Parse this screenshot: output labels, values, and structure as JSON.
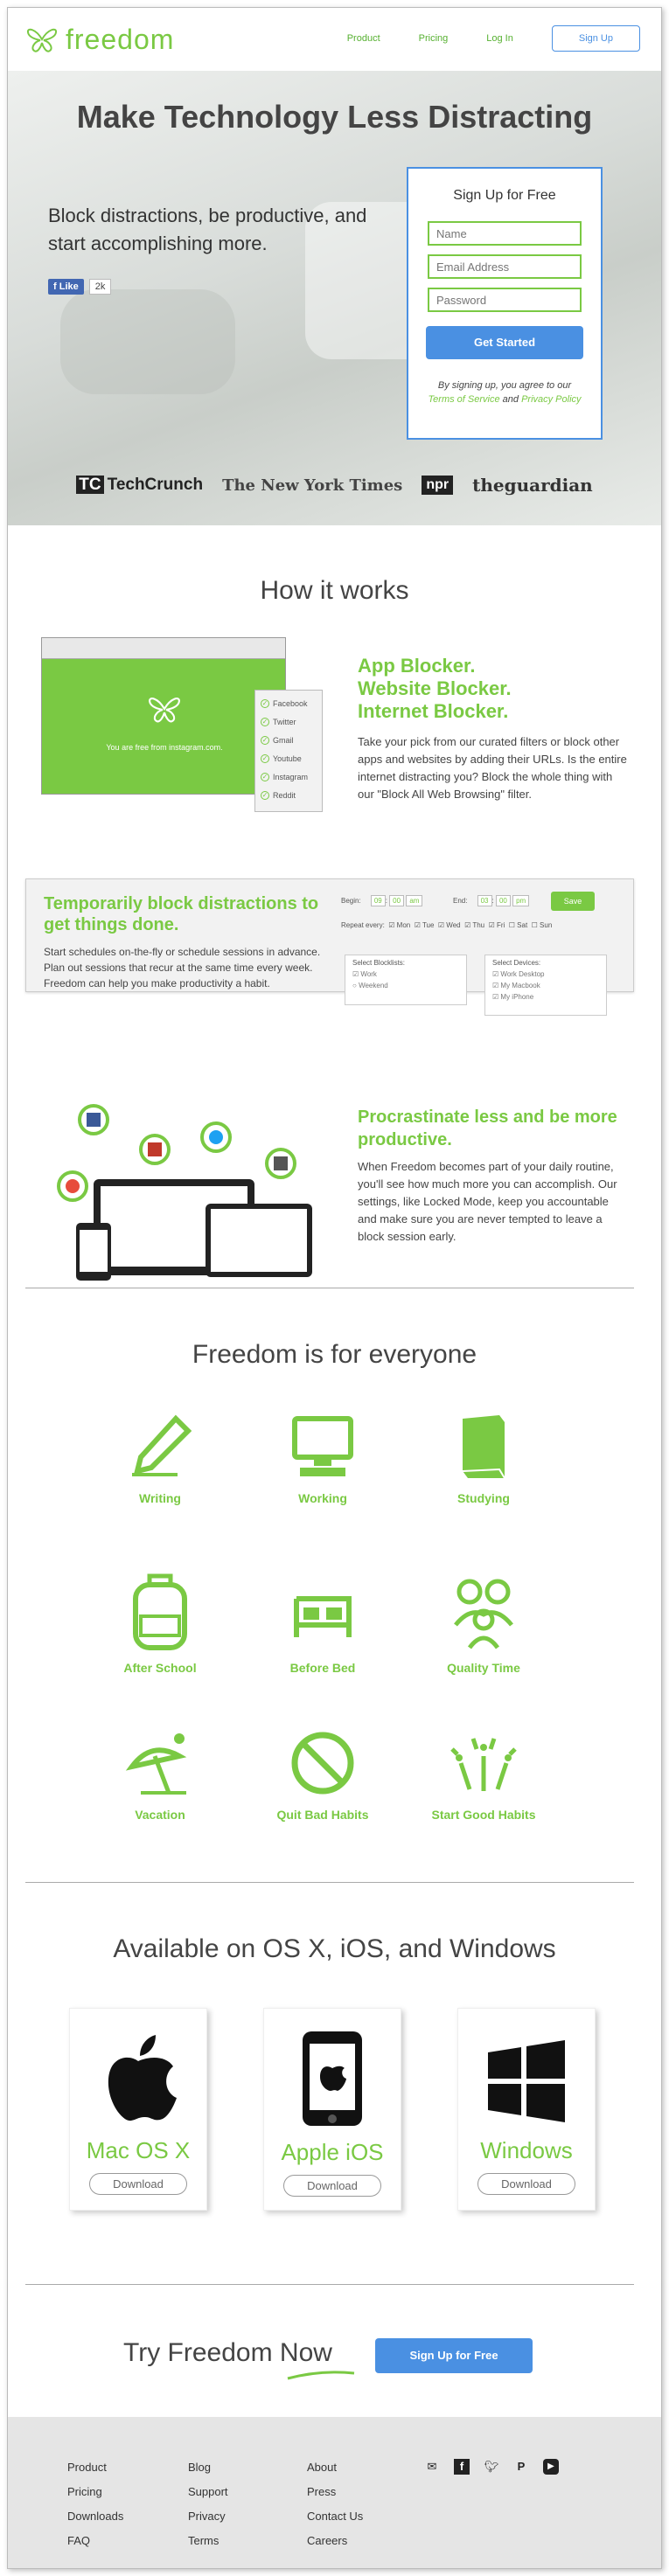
{
  "header": {
    "logo_text": "freedom",
    "nav": [
      {
        "label": "Product"
      },
      {
        "label": "Pricing"
      },
      {
        "label": "Log In"
      },
      {
        "label": "Sign Up"
      }
    ]
  },
  "hero": {
    "title": "Make Technology Less Distracting",
    "subtitle": "Block distractions, be productive, and start accomplishing more.",
    "fb_like": "Like",
    "fb_count": "2k",
    "signup": {
      "title": "Sign Up for Free",
      "name_placeholder": "Name",
      "email_placeholder": "Email Address",
      "password_placeholder": "Password",
      "button": "Get Started",
      "terms_prefix": "By signing up, you agree to our",
      "terms_link": "Terms of Service",
      "terms_and": "and",
      "privacy_link": "Privacy Policy"
    },
    "press": [
      "TechCrunch",
      "The New York Times",
      "npr",
      "theguardian"
    ]
  },
  "how": {
    "title": "How it works",
    "blocker": {
      "title_lines": [
        "App Blocker.",
        "Website Blocker.",
        "Internet Blocker."
      ],
      "text": "Take your pick from our curated filters or block other apps and websites by adding their URLs. Is the entire internet distracting you? Block the whole thing with our \"Block All Web Browsing\" filter.",
      "browser_message": "You are free from instagram.com.",
      "sites": [
        "Facebook",
        "Twitter",
        "Gmail",
        "Youtube",
        "Instagram",
        "Reddit"
      ]
    },
    "schedule": {
      "title": "Temporarily block distractions to get things done.",
      "text": "Start schedules on-the-fly or schedule sessions in advance. Plan out sessions that recur at the same time every week. Freedom can  help you make productivity a habit.",
      "begin_label": "Begin:",
      "end_label": "End:",
      "begin_time": [
        "09",
        "00",
        "am"
      ],
      "end_time": [
        "03",
        "00",
        "pm"
      ],
      "save": "Save",
      "repeat_label": "Repeat every:",
      "days": [
        "Mon",
        "Tue",
        "Wed",
        "Thu",
        "Fri",
        "Sat",
        "Sun"
      ],
      "blocklist_title": "Select Blocklists:",
      "blocklists": [
        "Work",
        "Weekend"
      ],
      "devices_title": "Select Devices:",
      "devices": [
        "Work Desktop",
        "My Macbook",
        "My iPhone"
      ]
    },
    "procrastinate": {
      "title": "Procrastinate less and be more productive.",
      "text": "When Freedom becomes part of your daily routine, you'll see how much more you can accomplish. Our settings, like Locked Mode, keep you accountable and make sure you are never tempted to leave a block session early."
    }
  },
  "everyone": {
    "title": "Freedom is for everyone",
    "items": [
      {
        "label": "Writing",
        "icon": "pencil-icon"
      },
      {
        "label": "Working",
        "icon": "computer-icon"
      },
      {
        "label": "Studying",
        "icon": "book-icon"
      },
      {
        "label": "After School",
        "icon": "backpack-icon"
      },
      {
        "label": "Before Bed",
        "icon": "bed-icon"
      },
      {
        "label": "Quality Time",
        "icon": "family-icon"
      },
      {
        "label": "Vacation",
        "icon": "umbrella-icon"
      },
      {
        "label": "Quit Bad Habits",
        "icon": "no-icon"
      },
      {
        "label": "Start Good Habits",
        "icon": "fireworks-icon"
      }
    ]
  },
  "platforms": {
    "title": "Available on OS X, iOS, and Windows",
    "items": [
      {
        "name": "Mac OS X",
        "download": "Download"
      },
      {
        "name": "Apple iOS",
        "download": "Download"
      },
      {
        "name": "Windows",
        "download": "Download"
      }
    ]
  },
  "try": {
    "text": "Try Freedom Now",
    "button": "Sign Up for Free"
  },
  "footer": {
    "col1": [
      "Product",
      "Pricing",
      "Downloads",
      "FAQ"
    ],
    "col2": [
      "Blog",
      "Support",
      "Privacy",
      "Terms"
    ],
    "col3": [
      "About",
      "Press",
      "Contact Us",
      "Careers"
    ],
    "social_icons": [
      "mail-icon",
      "facebook-icon",
      "twitter-icon",
      "pinterest-icon",
      "youtube-icon"
    ]
  },
  "colors": {
    "brand_green": "#7ac943",
    "brand_blue": "#4a90e2"
  }
}
